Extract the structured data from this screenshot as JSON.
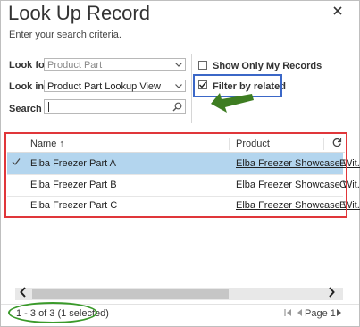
{
  "dialog": {
    "title": "Look Up Record",
    "subtitle": "Enter your search criteria.",
    "close_icon": "close-icon"
  },
  "form": {
    "look_for_label": "Look for",
    "look_for_value": "Product Part",
    "look_in_label": "Look in",
    "look_in_value": "Product Part Lookup View",
    "search_label": "Search",
    "search_value": "",
    "search_icon": "search-icon"
  },
  "options": {
    "show_only_my_records": "Show Only My Records",
    "show_only_my_records_checked": false,
    "filter_by_related": "Filter by related",
    "filter_by_related_checked": true
  },
  "grid": {
    "columns": [
      "Name ↑",
      "Product"
    ],
    "refresh_icon": "refresh-icon",
    "rows": [
      {
        "name": "Elba Freezer Part A",
        "product": "Elba Freezer Showcase Wit...",
        "trail": "E",
        "selected": true
      },
      {
        "name": "Elba Freezer Part B",
        "product": "Elba Freezer Showcase Wit...",
        "trail": "C",
        "selected": false
      },
      {
        "name": "Elba Freezer Part C",
        "product": "Elba Freezer Showcase Wit...",
        "trail": "E",
        "selected": false
      }
    ]
  },
  "footer": {
    "status": "1 - 3 of 3 (1 selected)",
    "page_label": "Page 1"
  },
  "colors": {
    "selected_row": "#b3d5ee",
    "highlight_blue": "#3b67c7",
    "highlight_red": "#e0363a",
    "highlight_green": "#3a9a2a",
    "arrow_green": "#3e7d22"
  }
}
